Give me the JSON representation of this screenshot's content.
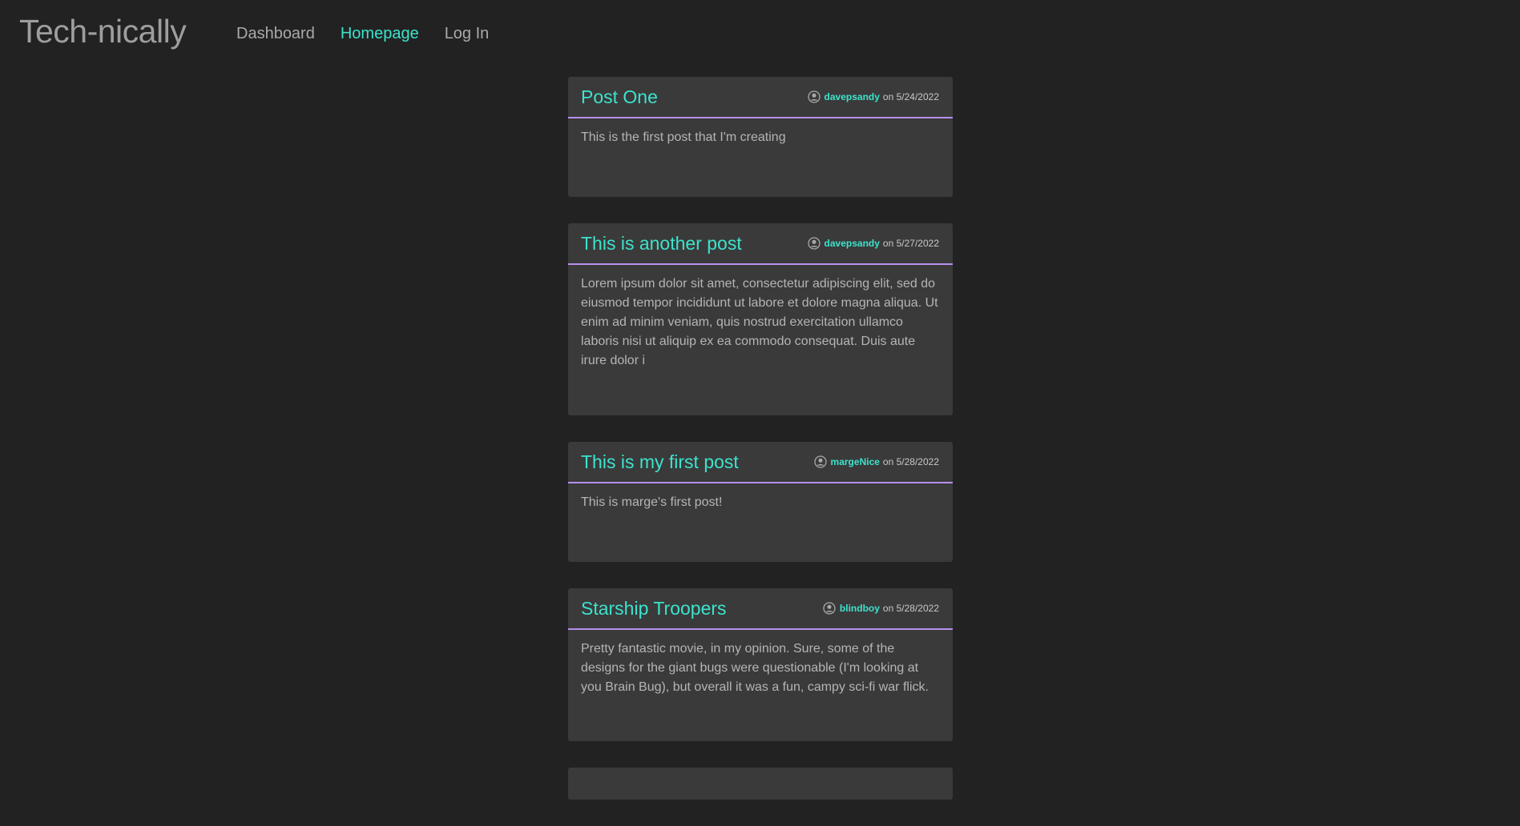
{
  "nav": {
    "brand": "Tech-nically",
    "links": [
      {
        "label": "Dashboard"
      },
      {
        "label": "Homepage"
      },
      {
        "label": "Log In"
      }
    ]
  },
  "accent_color": "#3ce3cd",
  "divider_color": "#b690f0",
  "posts": [
    {
      "title": "Post One",
      "author": "davepsandy",
      "date_text": "on 5/24/2022",
      "body": "This is the first post that I'm creating"
    },
    {
      "title": "This is another post",
      "author": "davepsandy",
      "date_text": "on 5/27/2022",
      "body": "Lorem ipsum dolor sit amet, consectetur adipiscing elit, sed do eiusmod tempor incididunt ut labore et dolore magna aliqua. Ut enim ad minim veniam, quis nostrud exercitation ullamco laboris nisi ut aliquip ex ea commodo consequat. Duis aute irure dolor i"
    },
    {
      "title": "This is my first post",
      "author": "margeNice",
      "date_text": "on 5/28/2022",
      "body": "This is marge's first post!"
    },
    {
      "title": "Starship Troopers",
      "author": "blindboy",
      "date_text": "on 5/28/2022",
      "body": "Pretty fantastic movie, in my opinion. Sure, some of the designs for the giant bugs were questionable (I'm looking at you Brain Bug), but overall it was a fun, campy sci-fi war flick."
    }
  ]
}
